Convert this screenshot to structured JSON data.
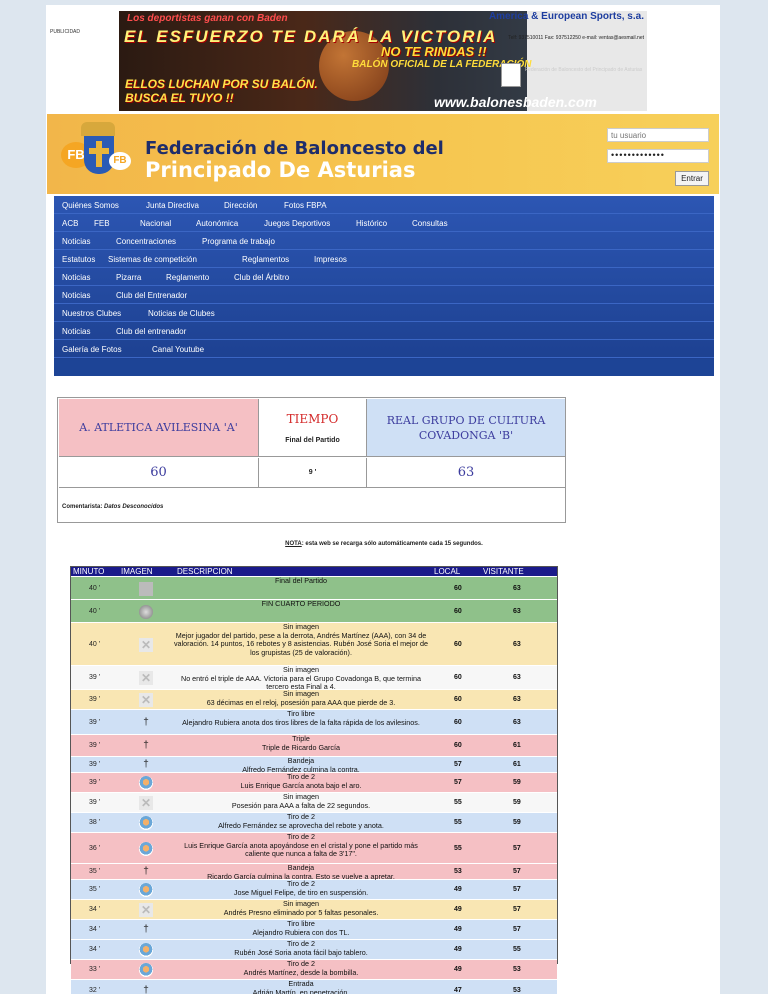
{
  "pub": {
    "label": "PUBLICIDAD"
  },
  "banner": {
    "line1": "Los deportistas ganan con Baden",
    "line2": "EL ESFUERZO TE DARÁ LA VICTORIA",
    "line3": "NO TE RINDAS !!",
    "line4": "BALÓN OFICIAL DE LA FEDERACIÓN",
    "line5": "ELLOS LUCHAN POR SU BALÓN.",
    "line6": "BUSCA EL TUYO !!",
    "url": "www.balonesbaden.com",
    "brand": "America & European Sports, s.a.",
    "contact": "Telf: 937510011 Fax: 937512250 e-mail: ventas@aesmail.net",
    "fed_small": "Federación de Baloncesto del Principado de Asturias"
  },
  "header": {
    "title1": "Federación de Baloncesto del",
    "title2": "Principado De Asturias",
    "logo_text": "FB"
  },
  "login": {
    "user_placeholder": "tu usuario",
    "password_value": "•••••••••••••",
    "submit": "Entrar"
  },
  "nav": {
    "rows": [
      [
        "Quiénes Somos",
        "Junta Directiva",
        "Dirección",
        "Fotos FBPA"
      ],
      [
        "ACB",
        "FEB",
        "Nacional",
        "Autonómica",
        "Juegos Deportivos",
        "Histórico",
        "Consultas"
      ],
      [
        "Noticias",
        "Concentraciones",
        "Programa de trabajo"
      ],
      [
        "Estatutos",
        "Sistemas de competición",
        "Reglamentos",
        "Impresos"
      ],
      [
        "Noticias",
        "Pizarra",
        "Reglamento",
        "Club del Árbitro"
      ],
      [
        "Noticias",
        "Club del Entrenador"
      ],
      [
        "Nuestros Clubes",
        "Noticias de Clubes"
      ],
      [
        "Noticias",
        "Club del entrenador"
      ],
      [
        "Galería de Fotos",
        "Canal Youtube"
      ]
    ]
  },
  "score": {
    "home": "A. ATLETICA AVILESINA 'A'",
    "tiempo": "TIEMPO",
    "estado": "Final del Partido",
    "away": "REAL GRUPO DE CULTURA COVADONGA 'B'",
    "home_score": "60",
    "period": "9 '",
    "away_score": "63",
    "comentarista_label": "Comentarista:",
    "comentarista": "Datos Desconocidos"
  },
  "nota": {
    "label": "NOTA",
    "text": ": esta web se recarga sólo automáticamente cada 15 segundos."
  },
  "table": {
    "headers": {
      "minuto": "MINUTO",
      "imagen": "IMAGEN",
      "descripcion": "DESCRIPCION",
      "local": "LOCAL",
      "visitante": "VISITANTE"
    },
    "rows": [
      {
        "min": "40 '",
        "icon": "board",
        "desc": "Final del Partido",
        "local": "60",
        "vis": "63",
        "color": "#8fc18a"
      },
      {
        "min": "40 '",
        "icon": "ball",
        "desc": "FIN CUARTO PERIODO",
        "local": "60",
        "vis": "63",
        "color": "#8fc18a"
      },
      {
        "min": "40 '",
        "icon": "x",
        "desc": "Sin imagen\nMejor jugador del partido, pese a la derrota, Andrés Martínez (AAA), con 34 de valoración. 14 puntos, 16 rebotes y 8 asistencias. Rubén José Soria el mejor de los grupistas (25 de valoración).",
        "local": "60",
        "vis": "63",
        "color": "#f9e6b3"
      },
      {
        "min": "39 '",
        "icon": "x",
        "desc": "Sin imagen\nNo entró el triple de AAA. Victoria para el Grupo Covadonga B, que termina tercero esta Final a 4.",
        "local": "60",
        "vis": "63",
        "color": "#f7f7f7"
      },
      {
        "min": "39 '",
        "icon": "x",
        "desc": "Sin imagen\n63 décimas en el reloj, posesión para AAA que pierde de 3.",
        "local": "60",
        "vis": "63",
        "color": "#f9e6b3"
      },
      {
        "min": "39 '",
        "icon": "fig",
        "desc": "Tiro libre\nAlejandro Rubiera anota dos tiros libres de la falta rápida de los avilesinos.",
        "local": "60",
        "vis": "63",
        "color": "#cfe0f5"
      },
      {
        "min": "39 '",
        "icon": "fig",
        "desc": "Triple\nTriple de Ricardo García",
        "local": "60",
        "vis": "61",
        "color": "#f5c0c4"
      },
      {
        "min": "39 '",
        "icon": "fig",
        "desc": "Bandeja\nAlfredo Fernández culmina la contra.",
        "local": "57",
        "vis": "61",
        "color": "#cfe0f5"
      },
      {
        "min": "39 '",
        "icon": "hoop",
        "desc": "Tiro de 2\nLuis Enrique García anota bajo el aro.",
        "local": "57",
        "vis": "59",
        "color": "#f5c0c4"
      },
      {
        "min": "39 '",
        "icon": "x",
        "desc": "Sin imagen\nPosesión para AAA a falta de 22 segundos.",
        "local": "55",
        "vis": "59",
        "color": "#f7f7f7"
      },
      {
        "min": "38 '",
        "icon": "hoop",
        "desc": "Tiro de 2\nAlfredo Fernández se aprovecha del rebote y anota.",
        "local": "55",
        "vis": "59",
        "color": "#cfe0f5"
      },
      {
        "min": "36 '",
        "icon": "hoop",
        "desc": "Tiro de 2\nLuis Enrique García anota apoyándose en el cristal y pone el partido más caliente que nunca a falta de 3'17\".",
        "local": "55",
        "vis": "57",
        "color": "#f5c0c4"
      },
      {
        "min": "35 '",
        "icon": "fig",
        "desc": "Bandeja\nRicardo García culmina la contra. Esto se vuelve a apretar.",
        "local": "53",
        "vis": "57",
        "color": "#f5c0c4"
      },
      {
        "min": "35 '",
        "icon": "hoop",
        "desc": "Tiro de 2\nJose Miguel Felipe, de tiro en suspensión.",
        "local": "49",
        "vis": "57",
        "color": "#cfe0f5"
      },
      {
        "min": "34 '",
        "icon": "x",
        "desc": "Sin imagen\nAndrés Presno eliminado por 5 faltas pesonales.",
        "local": "49",
        "vis": "57",
        "color": "#f9e6b3"
      },
      {
        "min": "34 '",
        "icon": "fig",
        "desc": "Tiro libre\nAlejandro Rubiera con dos TL.",
        "local": "49",
        "vis": "57",
        "color": "#cfe0f5"
      },
      {
        "min": "34 '",
        "icon": "hoop",
        "desc": "Tiro de 2\nRubén José Soria anota fácil bajo tablero.",
        "local": "49",
        "vis": "55",
        "color": "#cfe0f5"
      },
      {
        "min": "33 '",
        "icon": "hoop",
        "desc": "Tiro de 2\nAndrés Martínez, desde la bombilla.",
        "local": "49",
        "vis": "53",
        "color": "#f5c0c4"
      },
      {
        "min": "32 '",
        "icon": "fig",
        "desc": "Entrada\nAdrián Martín, en penetración.",
        "local": "47",
        "vis": "53",
        "color": "#cfe0f5"
      }
    ]
  }
}
